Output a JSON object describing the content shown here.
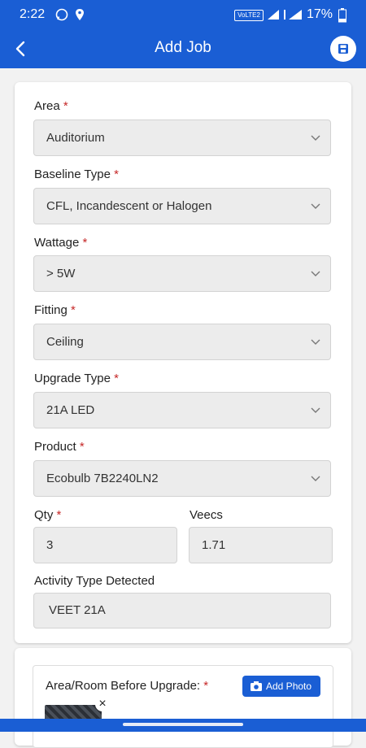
{
  "status_bar": {
    "time": "2:22",
    "battery_percent": "17%",
    "network_label": "VoLTE2",
    "icons": [
      "whatsapp-icon",
      "location-icon",
      "wifi-icon",
      "signal-icon",
      "signal-icon",
      "battery-icon"
    ]
  },
  "app_bar": {
    "title": "Add Job",
    "back_icon": "back-arrow-icon",
    "save_icon": "save-icon"
  },
  "colors": {
    "primary": "#1a5ed4",
    "required": "#c62828",
    "field_bg": "#ececec"
  },
  "form": {
    "required_mark": "*",
    "area": {
      "label": "Area",
      "value": "Auditorium"
    },
    "baseline_type": {
      "label": "Baseline Type",
      "value": "CFL, Incandescent or Halogen"
    },
    "wattage": {
      "label": "Wattage",
      "value": "> 5W"
    },
    "fitting": {
      "label": "Fitting",
      "value": "Ceiling"
    },
    "upgrade_type": {
      "label": "Upgrade Type",
      "value": "21A LED"
    },
    "product": {
      "label": "Product",
      "value": "Ecobulb 7B2240LN2"
    },
    "qty": {
      "label": "Qty",
      "value": "3"
    },
    "veecs": {
      "label": "Veecs",
      "value": "1.71"
    },
    "activity_type": {
      "label": "Activity Type Detected",
      "value": "VEET 21A"
    }
  },
  "photo_section": {
    "label": "Area/Room Before Upgrade:",
    "add_photo_label": "Add Photo",
    "remove_label": "×"
  }
}
